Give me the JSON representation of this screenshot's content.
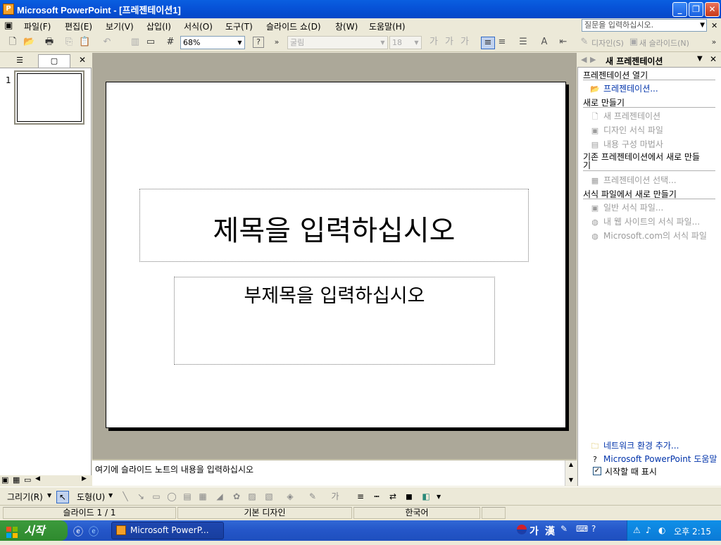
{
  "window": {
    "title": "Microsoft PowerPoint - [프레젠테이션1]",
    "app_icon": "powerpoint-icon"
  },
  "menu": {
    "items": [
      "파일(F)",
      "편집(E)",
      "보기(V)",
      "삽입(I)",
      "서식(O)",
      "도구(T)",
      "슬라이드 쇼(D)",
      "창(W)",
      "도움말(H)"
    ],
    "help_placeholder": "질문을 입력하십시오."
  },
  "toolbar": {
    "zoom": "68%",
    "font": "굴림",
    "font_size": "18",
    "design_label": "디자인(S)",
    "new_slide_label": "새 슬라이드(N)"
  },
  "slides_panel": {
    "slide_number": "1"
  },
  "slide": {
    "title_placeholder": "제목을 입력하십시오",
    "subtitle_placeholder": "부제목을 입력하십시오"
  },
  "notes": {
    "placeholder": "여기에 슬라이드 노트의 내용을 입력하십시오"
  },
  "task_pane": {
    "title": "새 프레젠테이션",
    "sections": [
      {
        "heading": "프레젠테이션 열기",
        "links": [
          {
            "label": "프레젠테이션...",
            "enabled": true,
            "icon": "open-folder-icon"
          }
        ]
      },
      {
        "heading": "새로 만들기",
        "links": [
          {
            "label": "새 프레젠테이션",
            "enabled": false,
            "icon": "blank-page-icon"
          },
          {
            "label": "디자인 서식 파일",
            "enabled": false,
            "icon": "design-template-icon"
          },
          {
            "label": "내용 구성 마법사",
            "enabled": false,
            "icon": "wizard-icon"
          }
        ]
      },
      {
        "heading": "기존 프레젠테이션에서 새로 만들기",
        "links": [
          {
            "label": "프레젠테이션 선택...",
            "enabled": false,
            "icon": "presentation-icon"
          }
        ]
      },
      {
        "heading": "서식 파일에서 새로 만들기",
        "links": [
          {
            "label": "일반 서식 파일...",
            "enabled": false,
            "icon": "template-icon"
          },
          {
            "label": "내 웹 사이트의 서식 파일...",
            "enabled": false,
            "icon": "web-template-icon"
          },
          {
            "label": "Microsoft.com의 서식 파일",
            "enabled": false,
            "icon": "online-template-icon"
          }
        ]
      }
    ],
    "footer_links": [
      {
        "label": "네트워크 환경 추가...",
        "icon": "network-folder-icon"
      },
      {
        "label": "Microsoft PowerPoint 도움말",
        "icon": "help-icon"
      }
    ],
    "show_at_startup_label": "시작할 때 표시",
    "show_at_startup_checked": true
  },
  "draw_toolbar": {
    "draw_label": "그리기(R)",
    "autoshapes_label": "도형(U)"
  },
  "status_bar": {
    "slide_info": "슬라이드 1 / 1",
    "design": "기본 디자인",
    "language": "한국어"
  },
  "taskbar": {
    "start_label": "시작",
    "task_button": "Microsoft PowerP...",
    "ime_mode": "가",
    "ime_hanja": "漢",
    "clock": "오후 2:15"
  }
}
